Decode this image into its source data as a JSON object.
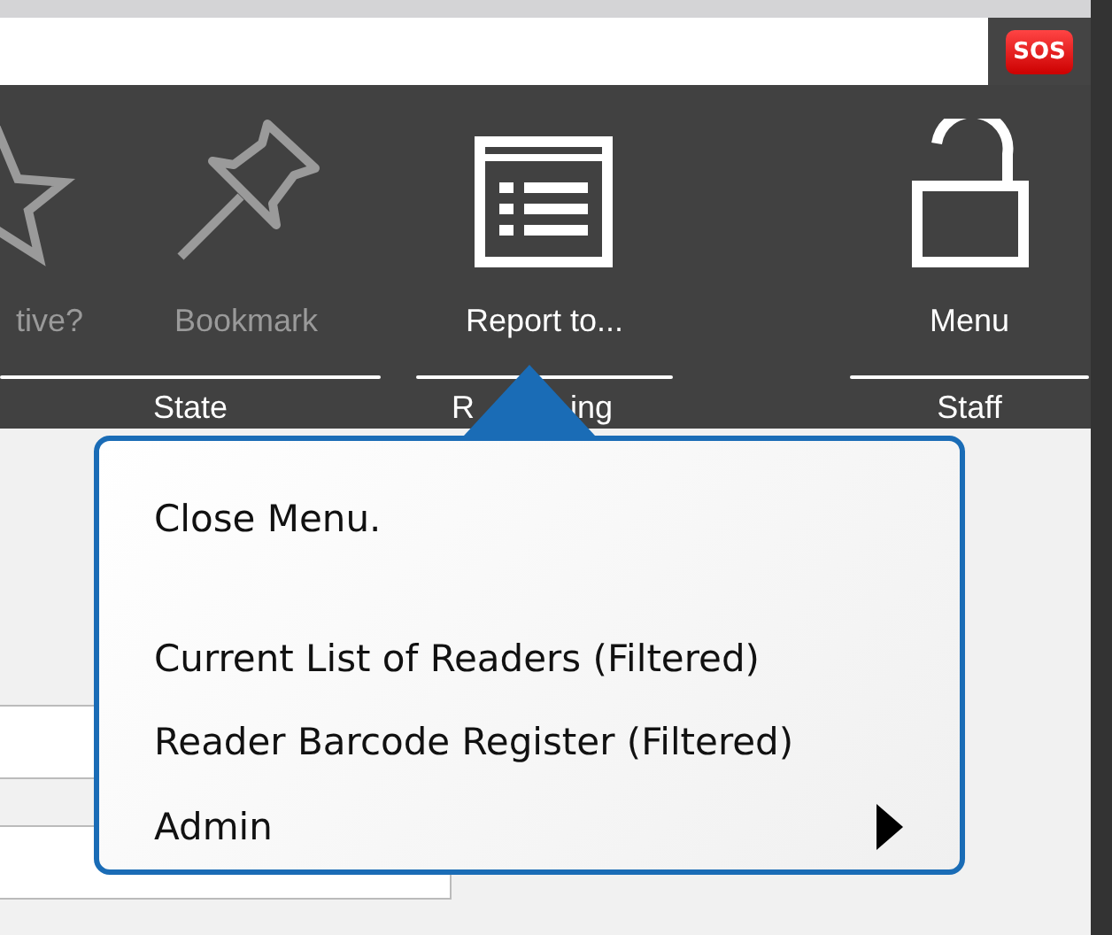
{
  "alert_button": {
    "label": "SOS"
  },
  "toolbar": {
    "groups": [
      {
        "label": "State",
        "buttons": [
          {
            "label": "tive?",
            "kind": "star",
            "disabled": true
          },
          {
            "label": "Bookmark",
            "kind": "pin",
            "disabled": true
          }
        ]
      },
      {
        "label_parts": [
          "R",
          "ing"
        ],
        "buttons": [
          {
            "label": "Report to...",
            "kind": "report",
            "disabled": false
          }
        ]
      },
      {
        "label": "Staff",
        "buttons": [
          {
            "label": "Menu",
            "kind": "lock",
            "disabled": false
          }
        ]
      }
    ]
  },
  "fields": [
    {
      "kind": "input"
    },
    {
      "kind": "input"
    }
  ],
  "popup_menu": {
    "items": [
      {
        "label": "Close Menu.",
        "kind": "close"
      },
      {
        "label": "Current List of Readers (Filtered)",
        "kind": "action"
      },
      {
        "label": "Reader Barcode Register (Filtered)",
        "kind": "action"
      },
      {
        "label": "Admin",
        "kind": "submenu"
      }
    ]
  }
}
